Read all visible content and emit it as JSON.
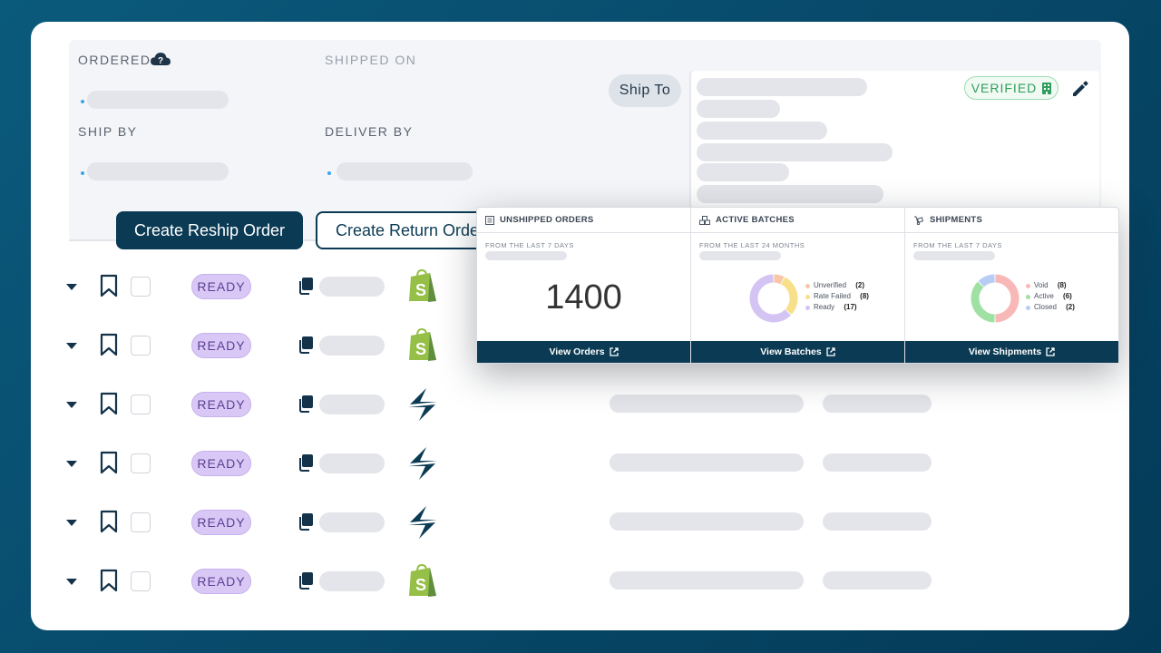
{
  "order_info": {
    "ordered_label": "ORDERED",
    "shipped_on_label": "SHIPPED ON",
    "ship_by_label": "SHIP BY",
    "deliver_by_label": "DELIVER BY",
    "ship_to_label": "Ship To",
    "verified_label": "VERIFIED"
  },
  "actions": {
    "reship_label": "Create Reship Order",
    "return_label": "Create Return Order"
  },
  "rows": [
    {
      "status": "READY",
      "channel": "shopify"
    },
    {
      "status": "READY",
      "channel": "shopify"
    },
    {
      "status": "READY",
      "channel": "shipstation"
    },
    {
      "status": "READY",
      "channel": "shipstation"
    },
    {
      "status": "READY",
      "channel": "shipstation"
    },
    {
      "status": "READY",
      "channel": "shopify"
    }
  ],
  "dashboard": {
    "unshipped": {
      "title": "UNSHIPPED ORDERS",
      "subtitle": "FROM THE LAST 7 DAYS",
      "value": "1400",
      "link_label": "View Orders"
    },
    "batches": {
      "title": "ACTIVE BATCHES",
      "subtitle": "FROM THE LAST 24 MONTHS",
      "link_label": "View Batches",
      "legend": [
        {
          "label": "Unverified",
          "count": "(2)",
          "value": 2,
          "color": "#f9c6a8"
        },
        {
          "label": "Rate Failed",
          "count": "(8)",
          "value": 8,
          "color": "#f8e08a"
        },
        {
          "label": "Ready",
          "count": "(17)",
          "value": 17,
          "color": "#d4c4f3"
        }
      ]
    },
    "shipments": {
      "title": "SHIPMENTS",
      "subtitle": "FROM THE LAST 7 DAYS",
      "link_label": "View Shipments",
      "legend": [
        {
          "label": "Void",
          "count": "(8)",
          "value": 8,
          "color": "#f9b8b8"
        },
        {
          "label": "Active",
          "count": "(6)",
          "value": 6,
          "color": "#9fe0a3"
        },
        {
          "label": "Closed",
          "count": "(2)",
          "value": 2,
          "color": "#b7cdf6"
        }
      ]
    }
  },
  "colors": {
    "primary": "#0b3b54",
    "ready_badge": "#d9c8f5",
    "verified": "#2f9d5b",
    "shopify_green": "#95bf47"
  }
}
